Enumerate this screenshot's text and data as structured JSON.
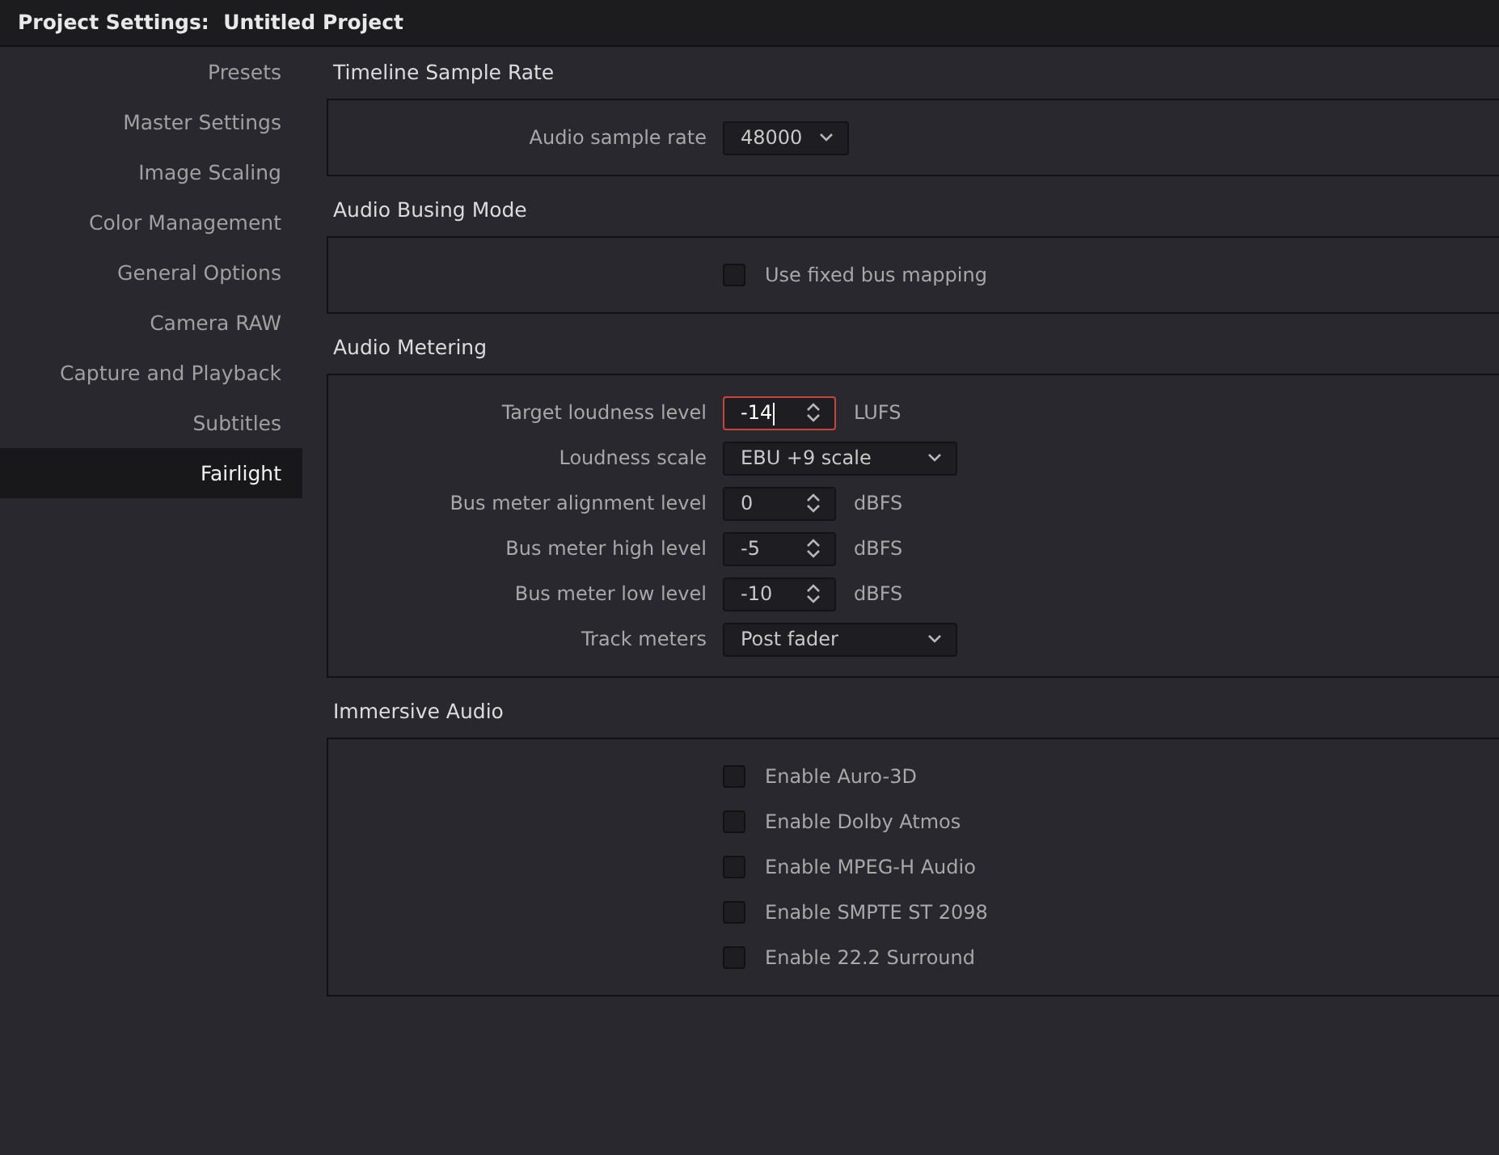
{
  "window": {
    "title": "Project Settings:  Untitled Project"
  },
  "sidebar": {
    "items": [
      {
        "label": "Presets",
        "selected": false
      },
      {
        "label": "Master Settings",
        "selected": false
      },
      {
        "label": "Image Scaling",
        "selected": false
      },
      {
        "label": "Color Management",
        "selected": false
      },
      {
        "label": "General Options",
        "selected": false
      },
      {
        "label": "Camera RAW",
        "selected": false
      },
      {
        "label": "Capture and Playback",
        "selected": false
      },
      {
        "label": "Subtitles",
        "selected": false
      },
      {
        "label": "Fairlight",
        "selected": true
      }
    ]
  },
  "sections": [
    {
      "title": "Timeline Sample Rate",
      "rows": [
        {
          "kind": "select",
          "label": "Audio sample rate",
          "value": "48000"
        }
      ]
    },
    {
      "title": "Audio Busing Mode",
      "rows": [
        {
          "kind": "checkbox",
          "label": "Use fixed bus mapping",
          "checked": false
        }
      ]
    },
    {
      "title": "Audio Metering",
      "rows": [
        {
          "kind": "spinner",
          "label": "Target loudness level",
          "value": "-14",
          "unit": "LUFS",
          "focused": true
        },
        {
          "kind": "select",
          "label": "Loudness scale",
          "value": "EBU +9 scale"
        },
        {
          "kind": "spinner",
          "label": "Bus meter alignment level",
          "value": "0",
          "unit": "dBFS",
          "focused": false
        },
        {
          "kind": "spinner",
          "label": "Bus meter high level",
          "value": "-5",
          "unit": "dBFS",
          "focused": false
        },
        {
          "kind": "spinner",
          "label": "Bus meter low level",
          "value": "-10",
          "unit": "dBFS",
          "focused": false
        },
        {
          "kind": "select",
          "label": "Track meters",
          "value": "Post fader"
        }
      ]
    },
    {
      "title": "Immersive Audio",
      "rows": [
        {
          "kind": "checkbox",
          "label": "Enable Auro-3D",
          "checked": false
        },
        {
          "kind": "checkbox",
          "label": "Enable Dolby Atmos",
          "checked": false
        },
        {
          "kind": "checkbox",
          "label": "Enable MPEG-H Audio",
          "checked": false
        },
        {
          "kind": "checkbox",
          "label": "Enable SMPTE ST 2098",
          "checked": false
        },
        {
          "kind": "checkbox",
          "label": "Enable 22.2 Surround",
          "checked": false
        }
      ]
    }
  ]
}
